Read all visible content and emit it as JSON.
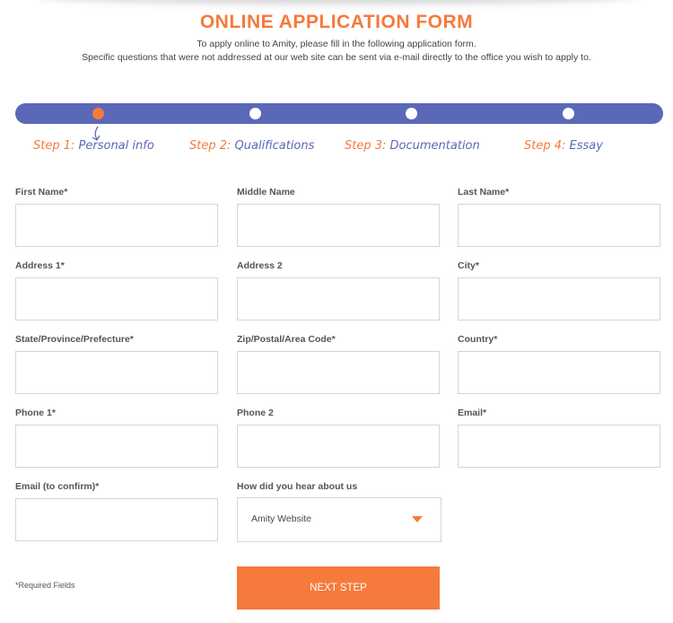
{
  "header": {
    "title": "ONLINE APPLICATION FORM",
    "subtitle_line1": "To apply online to Amity, please fill in the following application form.",
    "subtitle_line2": "Specific questions that were not addressed at our web site can be sent via e-mail directly to the office you wish to apply to."
  },
  "steps": [
    {
      "number": "Step 1:",
      "name": "Personal info",
      "active": true
    },
    {
      "number": "Step 2:",
      "name": "Qualifications",
      "active": false
    },
    {
      "number": "Step 3:",
      "name": "Documentation",
      "active": false
    },
    {
      "number": "Step 4:",
      "name": "Essay",
      "active": false
    }
  ],
  "fields": {
    "first_name": {
      "label": "First Name*",
      "value": ""
    },
    "middle_name": {
      "label": "Middle Name",
      "value": ""
    },
    "last_name": {
      "label": "Last Name*",
      "value": ""
    },
    "address1": {
      "label": "Address 1*",
      "value": ""
    },
    "address2": {
      "label": "Address 2",
      "value": ""
    },
    "city": {
      "label": "City*",
      "value": ""
    },
    "state": {
      "label": "State/Province/Prefecture*",
      "value": ""
    },
    "zip": {
      "label": "Zip/Postal/Area Code*",
      "value": ""
    },
    "country": {
      "label": "Country*",
      "value": ""
    },
    "phone1": {
      "label": "Phone 1*",
      "value": ""
    },
    "phone2": {
      "label": "Phone 2",
      "value": ""
    },
    "email": {
      "label": "Email*",
      "value": ""
    },
    "email_confirm": {
      "label": "Email (to confirm)*",
      "value": ""
    },
    "hear_about": {
      "label": "How did you hear about us",
      "selected": "Amity Website"
    }
  },
  "footer": {
    "required_note": "*Required Fields",
    "next_label": "NEXT STEP"
  },
  "colors": {
    "accent": "#f57a3b",
    "progress": "#5b68b8"
  }
}
